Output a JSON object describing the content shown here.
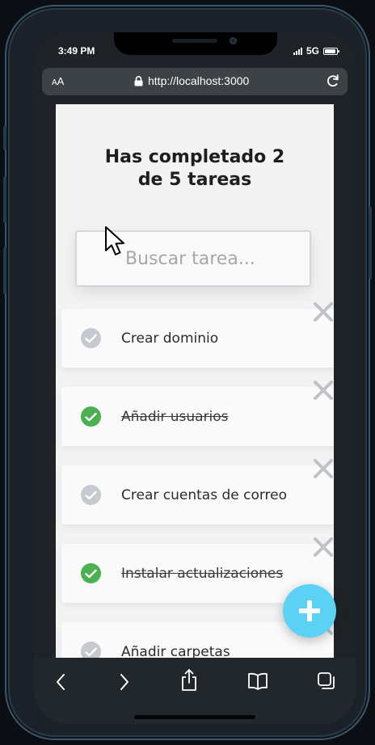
{
  "status_bar": {
    "time": "3:49 PM",
    "network": "5G"
  },
  "browser": {
    "text_size_label_small": "A",
    "text_size_label_large": "A",
    "url": "http://localhost:3000"
  },
  "app": {
    "counter_line1": "Has completado 2",
    "counter_line2": "de 5 tareas",
    "completed": 2,
    "total": 5,
    "search_placeholder": "Buscar tarea...",
    "tasks": [
      {
        "text": "Crear dominio",
        "completed": false
      },
      {
        "text": "Añadir usuarios",
        "completed": true
      },
      {
        "text": "Crear cuentas de correo",
        "completed": false
      },
      {
        "text": "Instalar actualizaciones",
        "completed": true
      },
      {
        "text": "Añadir carpetas",
        "completed": false
      }
    ]
  },
  "icons": {
    "check": "check-icon",
    "delete": "close-icon",
    "add": "plus-icon",
    "back": "chevron-left-icon",
    "forward": "chevron-right-icon",
    "share": "share-icon",
    "bookmarks": "book-icon",
    "tabs": "tabs-icon",
    "reload": "reload-icon",
    "lock": "lock-icon"
  },
  "colors": {
    "check_done": "#4caf50",
    "check_pending": "#c6c9cd",
    "delete": "#bfc2c6",
    "fab": "#5bd1f3"
  }
}
